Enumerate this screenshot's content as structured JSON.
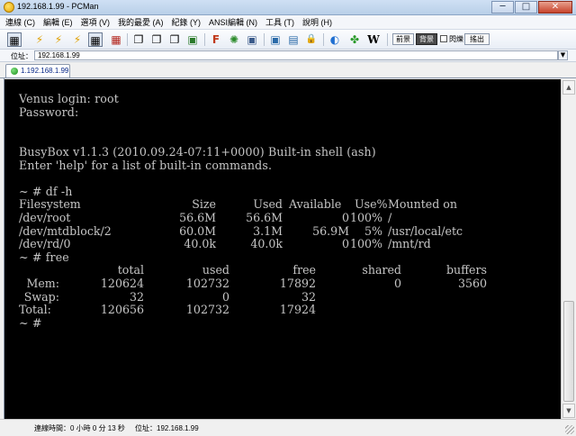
{
  "window": {
    "title": "192.168.1.99 - PCMan",
    "controls": [
      "─",
      "□",
      "✕"
    ]
  },
  "menu": [
    "連線 (C)",
    "編輯 (E)",
    "選項 (V)",
    "我的最愛 (A)",
    "紀錄 (Y)",
    "ANSI編輯 (N)",
    "工具 (T)",
    "說明 (H)"
  ],
  "toolbar": {
    "icons": [
      "connect-icon",
      "lightning-icon",
      "lightning-icon",
      "lightning-icon",
      "keyboard-icon",
      "cut-icon",
      "copy-icon",
      "paste-icon",
      "paste-special-icon",
      "image-icon",
      "font-icon",
      "gear-icon",
      "fullscreen-icon",
      "monitor-icon",
      "window-icon",
      "lock-icon",
      "browser-icon",
      "clover-icon",
      "wiki-icon"
    ],
    "glyphs": [
      "▦",
      "⚡",
      "⚡",
      "⚡",
      "▦",
      "▦",
      "❐",
      "❐",
      "❐",
      "▣",
      "F",
      "✺",
      "▣",
      "▣",
      "▤",
      "🔒",
      "◐",
      "✤",
      "W"
    ],
    "prev_label": "前景",
    "next_label": "背景",
    "blink_label": "閃爍",
    "exit_label": "搖出"
  },
  "address": {
    "label": "位址：",
    "value": "192.168.1.99"
  },
  "tab": {
    "label": "1.192.168.1.99"
  },
  "terminal": {
    "lines": [
      "Venus login: root",
      "Password:",
      "",
      "",
      "BusyBox v1.1.3 (2010.09.24-07:11+0000) Built-in shell (ash)",
      "Enter 'help' for a list of built-in commands.",
      "",
      "~ # df -h",
      "",
      "",
      "",
      "",
      "~ # free",
      "",
      "",
      "",
      "",
      "~ #"
    ],
    "df": {
      "headers": [
        "Filesystem",
        "Size",
        "Used",
        "Available",
        "Use%",
        "Mounted on"
      ],
      "rows": [
        [
          "/dev/root",
          "56.6M",
          "56.6M",
          "0",
          "100%",
          "/"
        ],
        [
          "/dev/mtdblock/2",
          "60.0M",
          "3.1M",
          "56.9M",
          "5%",
          "/usr/local/etc"
        ],
        [
          "/dev/rd/0",
          "40.0k",
          "40.0k",
          "0",
          "100%",
          "/mnt/rd"
        ]
      ]
    },
    "free": {
      "headers": [
        "total",
        "used",
        "free",
        "shared",
        "buffers"
      ],
      "rows": [
        [
          "Mem:",
          "120624",
          "102732",
          "17892",
          "0",
          "3560"
        ],
        [
          "Swap:",
          "32",
          "0",
          "32",
          "",
          ""
        ],
        [
          "Total:",
          "120656",
          "102732",
          "17924",
          "",
          ""
        ]
      ]
    }
  },
  "status": {
    "connected_time": "連線時間：0 小時 0 分 13 秒",
    "address": "位址：192.168.1.99"
  }
}
